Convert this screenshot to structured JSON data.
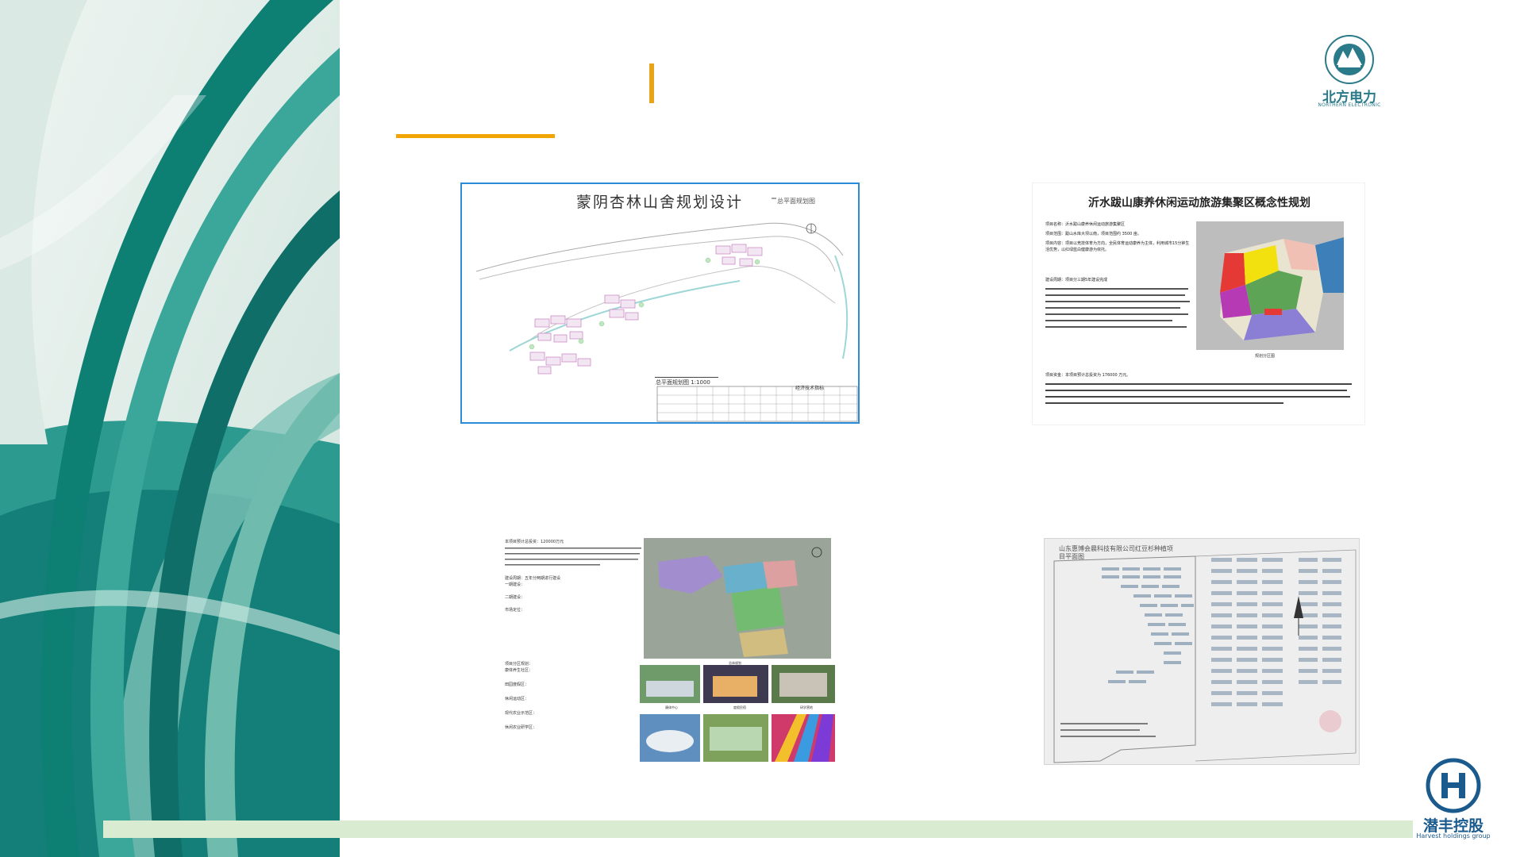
{
  "theme": {
    "accent": "#f0a500",
    "teal_dark": "#12807a",
    "teal_light": "#b9d9d2",
    "bar_green": "#d9ebd1",
    "brand_blue": "#1a5a8c"
  },
  "logos": {
    "northern_electric": {
      "cn": "北方电力",
      "en": "NORTHERN ELECTRONIC",
      "ring_text": "北方电力公司 NORTHERN ELECTRONIC"
    },
    "harvest": {
      "cn": "潜丰控股",
      "en": "Harvest holdings group",
      "mark": "H"
    }
  },
  "thumbnails": [
    {
      "title": "蒙阴杏林山舍规划设计",
      "subtitle": "总平面规划图",
      "scale_label": "总平面规划图 1:1000",
      "table_title": "经济技术指标"
    },
    {
      "title": "沂水跋山康养休闲运动旅游集聚区概念性规划",
      "caption": "规划分区图",
      "lines": [
        "项目名称：沂水跋山康养休闲运动旅游集聚区",
        "项目范围：跋山水库大坝以南，项目范围约 3500 亩。",
        "项目内容：项目以竞技体育为方向，全民体育运动康养为主体，利用城市15分钟生活优势，以红绿蓝白健康游为依托。",
        "建设周期：项目分三期5年建设完成",
        "项目资金：本项目预计总投资为 176000 万元。"
      ]
    },
    {
      "lines": [
        "本项目预计总投资：120000万元",
        "建设周期：五年分两期进行建设",
        "一期建设：",
        "二期建设：",
        "市场定位：",
        "项目分区规划：",
        "康体养生社区：",
        "田园度假区：",
        "休闲运动区：",
        "现代农业示范区：",
        "休闲农业研学区："
      ],
      "captions": [
        "总体规划",
        "康体中心",
        "度假民宿",
        "研学营地"
      ]
    },
    {
      "title": "山东惠博会晨科技有限公司红豆杉种植项目平面图"
    }
  ]
}
